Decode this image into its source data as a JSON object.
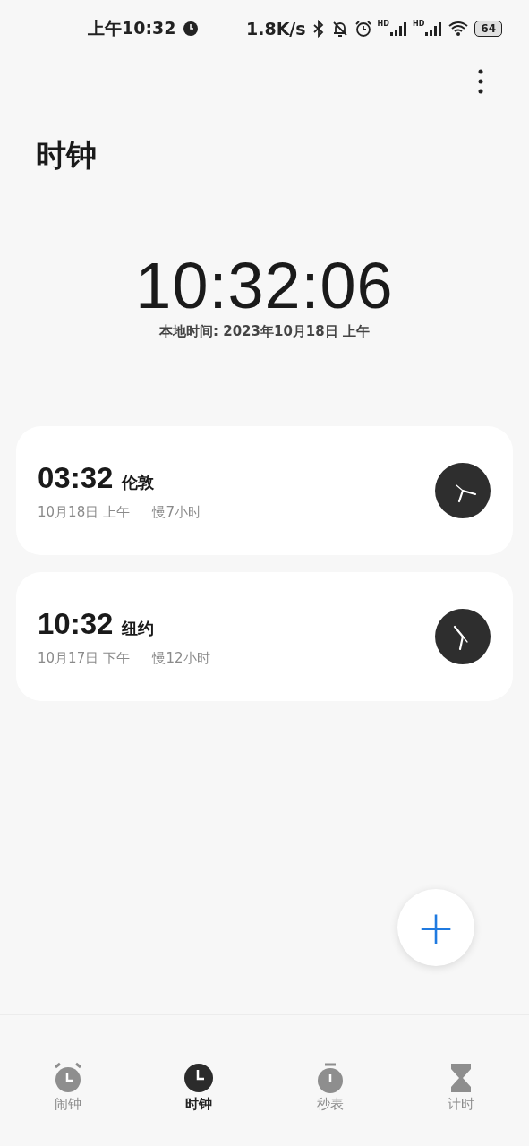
{
  "status_bar": {
    "time": "上午10:32",
    "speed": "1.8K/s",
    "signals": [
      {
        "label": "HD"
      },
      {
        "label": "HD"
      }
    ],
    "battery": "64"
  },
  "title": "时钟",
  "local_clock": {
    "time": "10:32:06",
    "date": "本地时间: 2023年10月18日 上午"
  },
  "world_clocks": [
    {
      "time": "03:32",
      "city": "伦敦",
      "date": "10月18日 上午",
      "offset": "慢7小时"
    },
    {
      "time": "10:32",
      "city": "纽约",
      "date": "10月17日 下午",
      "offset": "慢12小时"
    }
  ],
  "add_button": {
    "label": "+"
  },
  "tabs": [
    {
      "kind": "alarm",
      "label": "闹钟",
      "selected": false
    },
    {
      "kind": "clock",
      "label": "时钟",
      "selected": true
    },
    {
      "kind": "stopwatch",
      "label": "秒表",
      "selected": false
    },
    {
      "kind": "timer",
      "label": "计时",
      "selected": false
    }
  ]
}
